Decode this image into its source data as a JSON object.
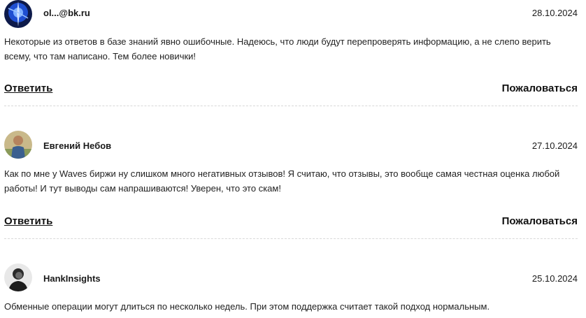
{
  "comments": [
    {
      "author": "ol...@bk.ru",
      "date": "28.10.2024",
      "text": "Некоторые из ответов в базе знаний явно ошибочные. Надеюсь, что люди будут перепроверять информацию, а не слепо верить всему, что там написано. Тем более новички!",
      "reply_label": "Ответить",
      "report_label": "Пожаловаться"
    },
    {
      "author": "Евгений Небов",
      "date": "27.10.2024",
      "text": "Как по мне у Waves биржи ну слишком много негативных отзывов! Я считаю, что отзывы, это вообще самая честная оценка любой работы! И тут выводы сам напрашиваются! Уверен, что это скам!",
      "reply_label": "Ответить",
      "report_label": "Пожаловаться"
    },
    {
      "author": "HankInsights",
      "date": "25.10.2024",
      "text": "Обменные операции могут длиться по несколько недель. При этом поддержка считает такой подход нормальным."
    }
  ]
}
